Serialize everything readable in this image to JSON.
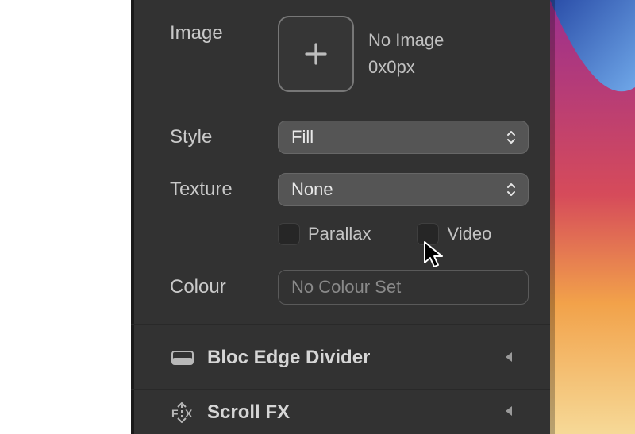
{
  "image": {
    "label": "Image",
    "no_image_text": "No Image",
    "dimensions": "0x0px"
  },
  "style": {
    "label": "Style",
    "value": "Fill"
  },
  "texture": {
    "label": "Texture",
    "value": "None"
  },
  "parallax": {
    "label": "Parallax",
    "checked": false
  },
  "video": {
    "label": "Video",
    "checked": false
  },
  "colour": {
    "label": "Colour",
    "placeholder": "No Colour Set"
  },
  "sections": {
    "edge_divider": "Bloc Edge Divider",
    "scroll_fx": "Scroll FX"
  }
}
